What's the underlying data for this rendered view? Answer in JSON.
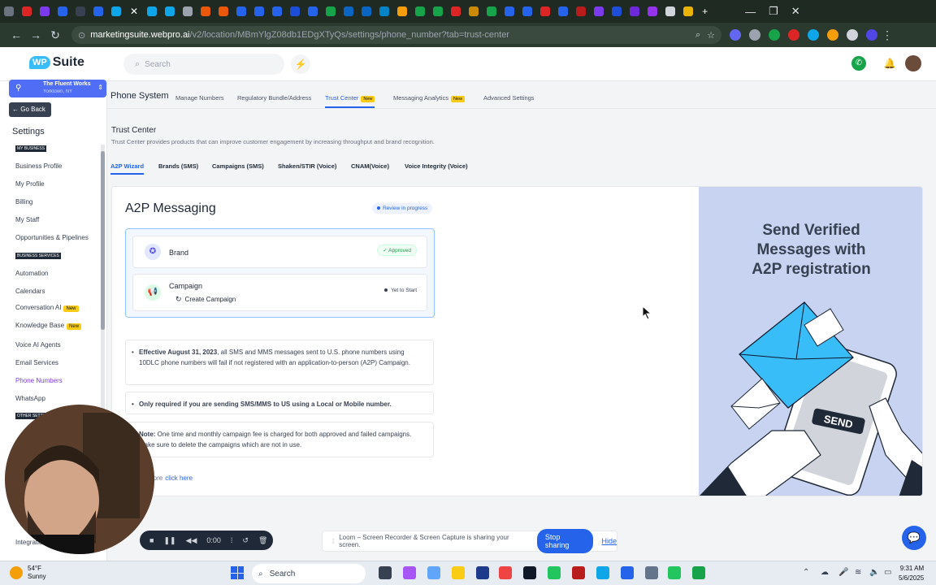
{
  "browser": {
    "url_host": "marketingsuite.webpro.ai",
    "url_path": "/v2/location/MBmYlgZ08db1EDgXTyQs/settings/phone_number?tab=trust-center",
    "window_controls": [
      "—",
      "❐",
      "✕"
    ]
  },
  "header": {
    "logo_wp": "WP",
    "logo_suite": "Suite",
    "search_placeholder": "Search"
  },
  "sidebar": {
    "location_name": "The Fluent Works",
    "location_sub": "Yorktown, NY",
    "go_back": "Go Back",
    "title": "Settings",
    "section_my_business": "MY BUSINESS",
    "section_business_services": "BUSINESS SERVICES",
    "section_other": "OTHER SETTINGS",
    "items": [
      {
        "label": "Business Profile"
      },
      {
        "label": "My Profile"
      },
      {
        "label": "Billing"
      },
      {
        "label": "My Staff"
      },
      {
        "label": "Opportunities & Pipelines"
      },
      {
        "label": "Automation"
      },
      {
        "label": "Calendars"
      },
      {
        "label": "Conversation AI",
        "badge": "New"
      },
      {
        "label": "Knowledge Base",
        "badge": "New"
      },
      {
        "label": "Voice AI Agents"
      },
      {
        "label": "Email Services"
      },
      {
        "label": "Phone Numbers"
      },
      {
        "label": "WhatsApp"
      },
      {
        "label": "Integrations"
      }
    ]
  },
  "phone_system": {
    "title": "Phone System",
    "tabs": [
      {
        "label": "Manage Numbers"
      },
      {
        "label": "Regulatory Bundle/Address"
      },
      {
        "label": "Trust Center",
        "badge": "New"
      },
      {
        "label": "Messaging Analytics",
        "badge": "New"
      },
      {
        "label": "Advanced Settings"
      }
    ]
  },
  "trust_center": {
    "title": "Trust Center",
    "description": "Trust Center provides products that can improve customer engagement by increasing throughput and brand recognition.",
    "tabs": [
      {
        "label": "A2P Wizard"
      },
      {
        "label": "Brands (SMS)"
      },
      {
        "label": "Campaigns (SMS)"
      },
      {
        "label": "Shaken/STIR (Voice)"
      },
      {
        "label": "CNAM(Voice)"
      },
      {
        "label": "Voice Integrity (Voice)"
      }
    ]
  },
  "a2p": {
    "title": "A2P Messaging",
    "status_pill": "Review in progress",
    "brand_label": "Brand",
    "brand_status": "Approved",
    "campaign_label": "Campaign",
    "campaign_status": "Yet to Start",
    "create_campaign": "Create Campaign",
    "note1_bold": "Effective August 31, 2023",
    "note1_rest": ", all SMS and MMS messages sent to U.S. phone numbers using 10DLC phone numbers will fail if not registered with an application-to-person (A2P) Campaign.",
    "note2": "Only required if you are sending SMS/MMS to US using a Local or Mobile number.",
    "note3_bold": "Note:",
    "note3_rest": " One time and monthly campaign fee is charged for both approved and failed campaigns. Make sure to delete the campaigns which are not in use.",
    "learn_more_prefix": "more",
    "learn_more_link": "click here"
  },
  "promo": {
    "line1": "Send Verified",
    "line2": "Messages with",
    "line3": "A2P registration",
    "send_label": "SEND"
  },
  "loom": {
    "timer": "0:00",
    "share_text": "Loom – Screen Recorder & Screen Capture is sharing your screen.",
    "stop_label": "Stop sharing",
    "hide_label": "Hide"
  },
  "taskbar": {
    "temp": "54°F",
    "weather": "Sunny",
    "search": "Search",
    "time": "9:31 AM",
    "date": "5/6/2025"
  }
}
